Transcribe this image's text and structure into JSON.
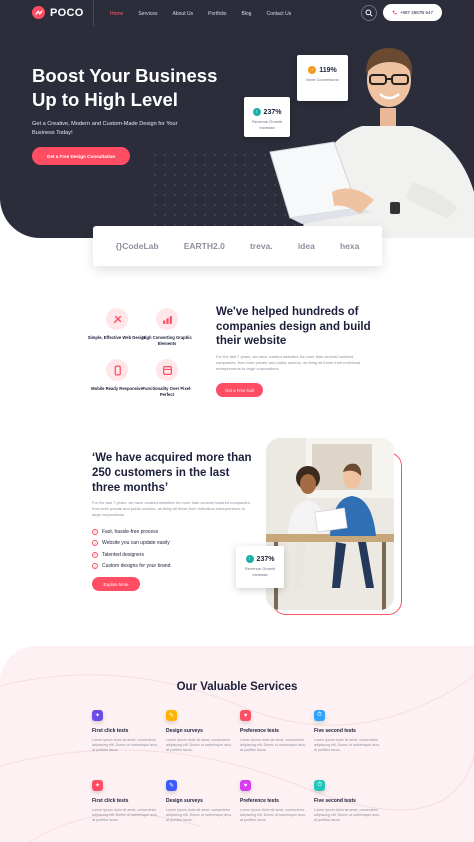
{
  "brand": {
    "name": "POCO",
    "accent": "#ff4d63",
    "dark": "#2b2d3b"
  },
  "nav": {
    "items": [
      "Home",
      "Services",
      "About Us",
      "Portfolio",
      "Blog",
      "Contact Us"
    ],
    "active": "Home",
    "phone": "+987 4567B 547"
  },
  "hero": {
    "title": "Boost Your Business Up to High Level",
    "subtitle": "Get a Creative, Modern and Custom-Made Design for Your Business Today!",
    "cta": "Get a Free Design Consultation",
    "stat1": {
      "value": "237%",
      "label": "Revenue Growth Increase"
    },
    "stat2": {
      "value": "119%",
      "label": "More Conversions"
    }
  },
  "logos": [
    "{}CodeLab",
    "EARTH2.0",
    "treva.",
    "idea",
    "hexa"
  ],
  "features": [
    {
      "label": "Simple, Effective Web Design",
      "icon": "design-icon"
    },
    {
      "label": "High Converting Graphic Elements",
      "icon": "chart-icon"
    },
    {
      "label": "Mobile Ready Responsive",
      "icon": "mobile-icon"
    },
    {
      "label": "Functionality Over Pixel-Perfect",
      "icon": "layout-icon"
    }
  ],
  "section2": {
    "title": "We've helped hundreds of companies design and build their website",
    "text": "For the last 7 years, we have created websites for more than several hundred companies, from both private and public sectors, as thing all those from individual entrepreneurs to large corporations.",
    "cta": "Get a Free Call"
  },
  "section3": {
    "title": "‘We have acquired more than 250 customers in the last three months’",
    "text": "For the last 7 years, we have created websites for more than several hundred companies, from both private and public sectors, as thing all those from individual entrepreneurs to large corporations.",
    "checks": [
      "Fast, hassle-free process",
      "Website you can update easily",
      "Talented designers",
      "Custom designs for your brand"
    ],
    "cta": "Explore More",
    "stat": {
      "value": "237%",
      "label": "Revenue Growth Increase"
    }
  },
  "services": {
    "title": "Our Valuable Services",
    "lorem": "Lorem ipsum dolor sit amet, consectetur adipiscing elit. Donec ut scelerisque arcu, at porttitor lacus.",
    "items": [
      {
        "title": "First click tests",
        "color": "#6c4ce6"
      },
      {
        "title": "Design surveys",
        "color": "#ffb300"
      },
      {
        "title": "Preference tests",
        "color": "#ff4d63"
      },
      {
        "title": "Five second tests",
        "color": "#2fa4ff"
      },
      {
        "title": "First click tests",
        "color": "#ff4d63"
      },
      {
        "title": "Design surveys",
        "color": "#3d5afe"
      },
      {
        "title": "Preference tests",
        "color": "#d63cf0"
      },
      {
        "title": "Five second tests",
        "color": "#22c7b8"
      }
    ]
  }
}
